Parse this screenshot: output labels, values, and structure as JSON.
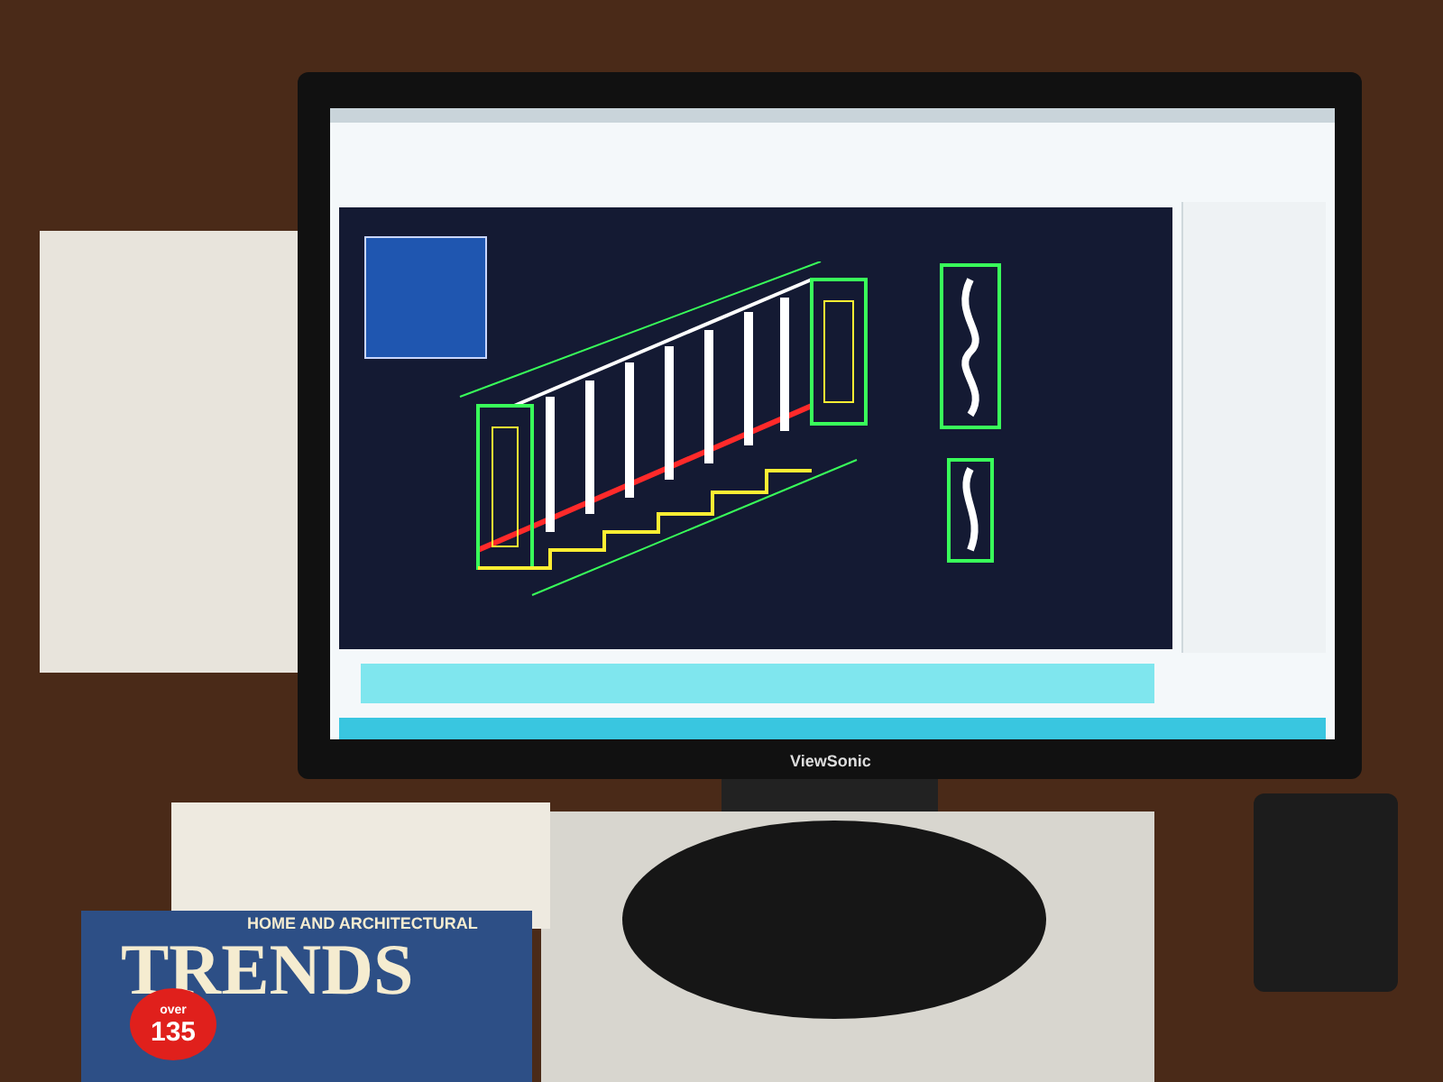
{
  "monitor": {
    "brand": "ViewSonic"
  },
  "magazine": {
    "kicker": "HOME AND ARCHITECTURAL",
    "title": "TRENDS",
    "sticker": {
      "line_1": "over",
      "line_2": "135"
    }
  }
}
